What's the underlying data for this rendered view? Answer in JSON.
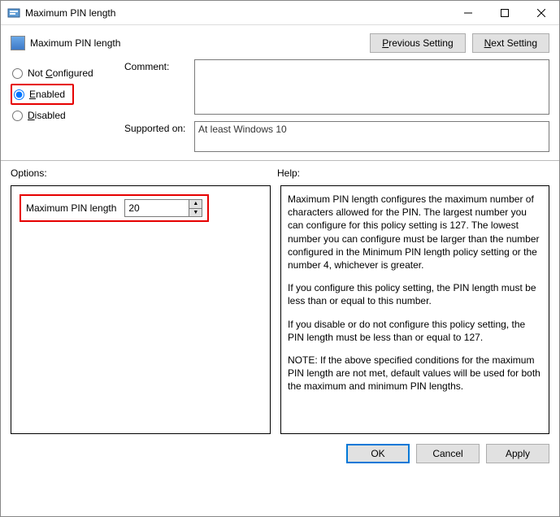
{
  "window": {
    "title": "Maximum PIN length"
  },
  "header": {
    "policy_title": "Maximum PIN length",
    "prev_prefix": "P",
    "prev_rest": "revious Setting",
    "next_prefix": "N",
    "next_rest": "ext Setting"
  },
  "state": {
    "not_configured": {
      "label_prefix": "Not ",
      "accel": "C",
      "label_rest": "onfigured",
      "selected": false
    },
    "enabled": {
      "accel": "E",
      "label_rest": "nabled",
      "selected": true
    },
    "disabled": {
      "accel": "D",
      "label_rest": "isabled",
      "selected": false
    },
    "comment_label": "Comment:",
    "comment_value": "",
    "supported_label": "Supported on:",
    "supported_value": "At least Windows 10"
  },
  "panels": {
    "options_label": "Options:",
    "help_label": "Help:"
  },
  "options": {
    "spinner_label": "Maximum PIN length",
    "spinner_value": "20"
  },
  "help": {
    "p1": "Maximum PIN length configures the maximum number of characters allowed for the PIN.  The largest number you can configure for this policy setting is 127. The lowest number you can configure must be larger than the number configured in the Minimum PIN length policy setting or the number 4, whichever is greater.",
    "p2": "If you configure this policy setting, the PIN length must be less than or equal to this number.",
    "p3": "If you disable or do not configure this policy setting, the PIN length must be less than or equal to 127.",
    "p4": "NOTE: If the above specified conditions for the maximum PIN length are not met, default values will be used for both the maximum and minimum PIN lengths."
  },
  "buttons": {
    "ok": "OK",
    "cancel": "Cancel",
    "apply": "Apply"
  }
}
